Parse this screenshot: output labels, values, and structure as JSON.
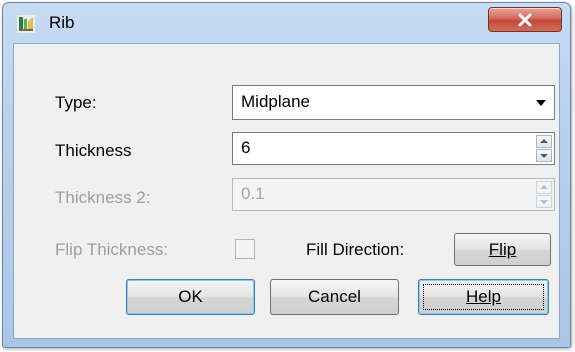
{
  "window": {
    "title": "Rib"
  },
  "form": {
    "type": {
      "label": "Type:",
      "value": "Midplane"
    },
    "thickness": {
      "label": "Thickness",
      "value": "6"
    },
    "thickness2": {
      "label": "Thickness 2:",
      "value": "0.1"
    },
    "flip_thickness": {
      "label": "Flip Thickness:",
      "checked": false
    },
    "fill_direction": {
      "label": "Fill Direction:"
    }
  },
  "buttons": {
    "flip": "Flip",
    "ok": "OK",
    "cancel": "Cancel",
    "help": "Help"
  }
}
